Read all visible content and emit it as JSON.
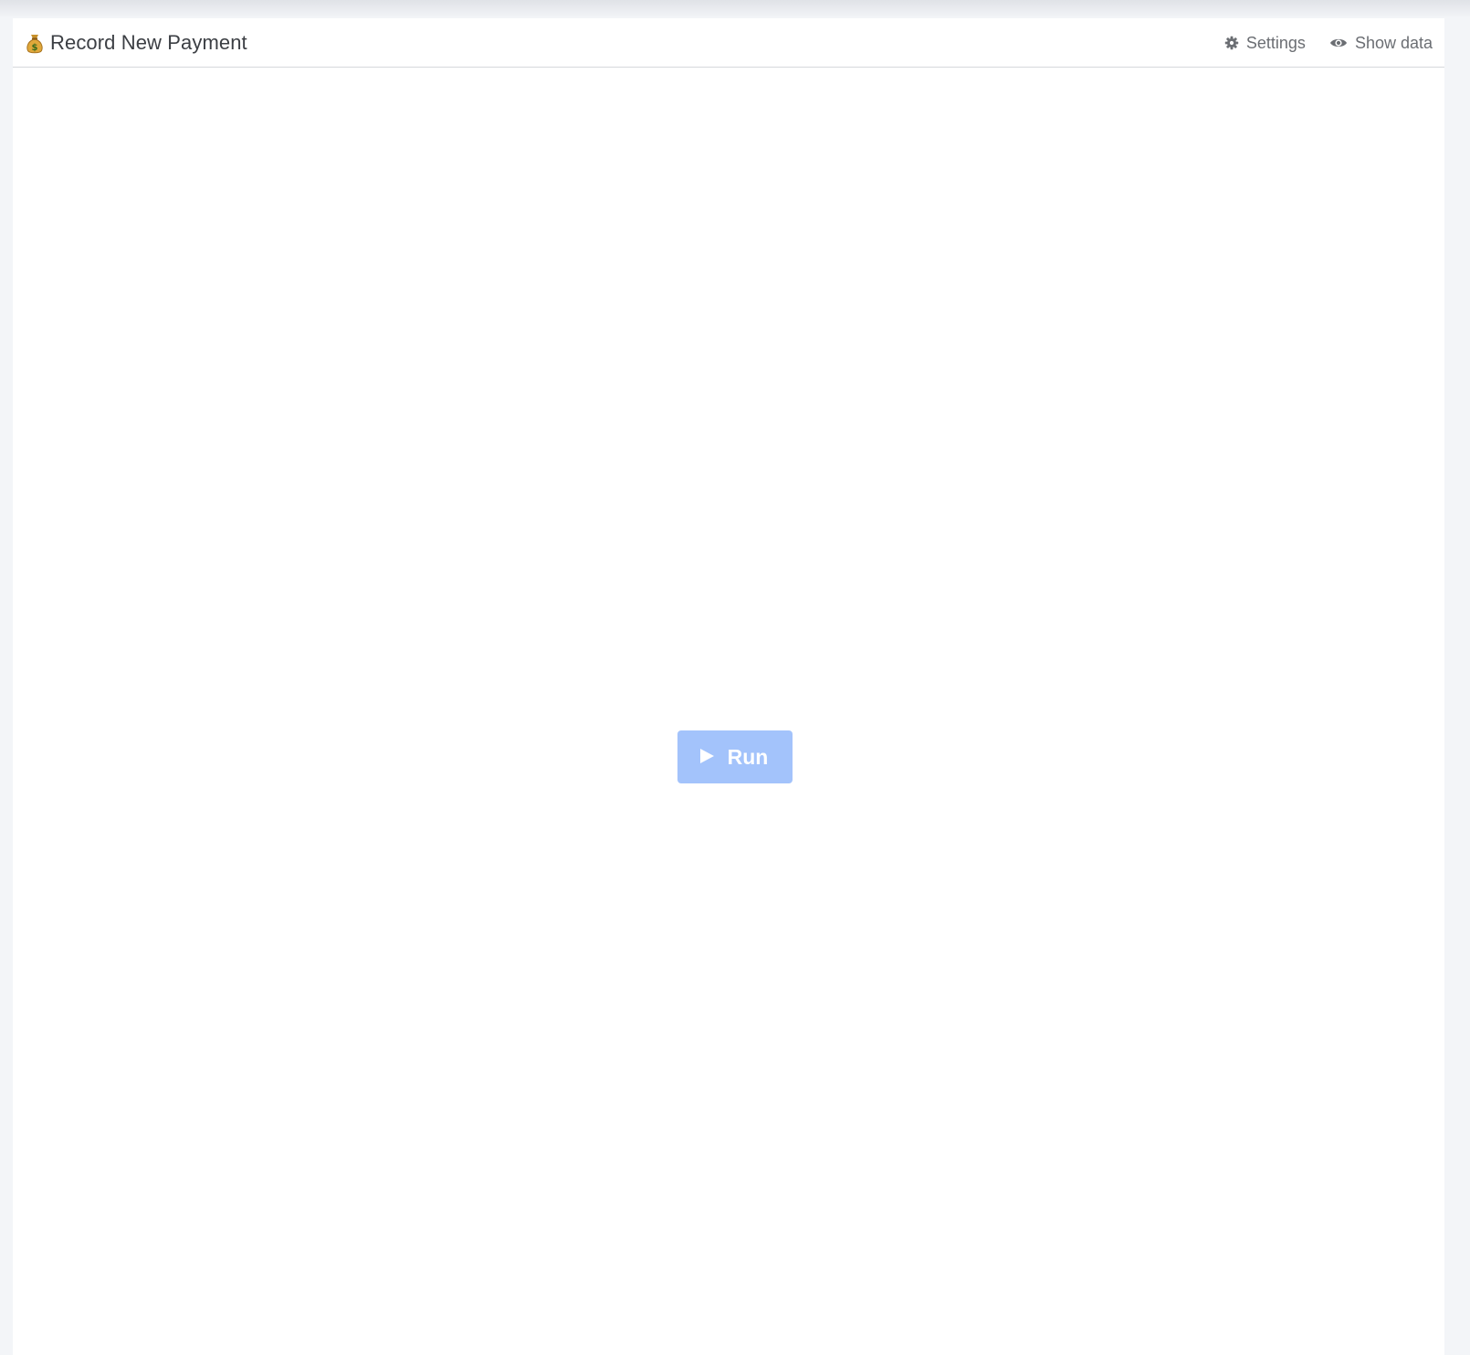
{
  "header": {
    "title": "Record New Payment",
    "title_icon": "money-bag-icon",
    "actions": [
      {
        "label": "Settings",
        "icon": "gear-icon"
      },
      {
        "label": "Show data",
        "icon": "eye-icon"
      }
    ]
  },
  "main": {
    "run_button": {
      "label": "Run",
      "icon": "play-icon"
    }
  },
  "colors": {
    "page_background": "#f3f5f8",
    "panel_background": "#ffffff",
    "run_button": "#a3c3fb",
    "action_text": "#6b6e73",
    "title_text": "#3c3f44"
  }
}
